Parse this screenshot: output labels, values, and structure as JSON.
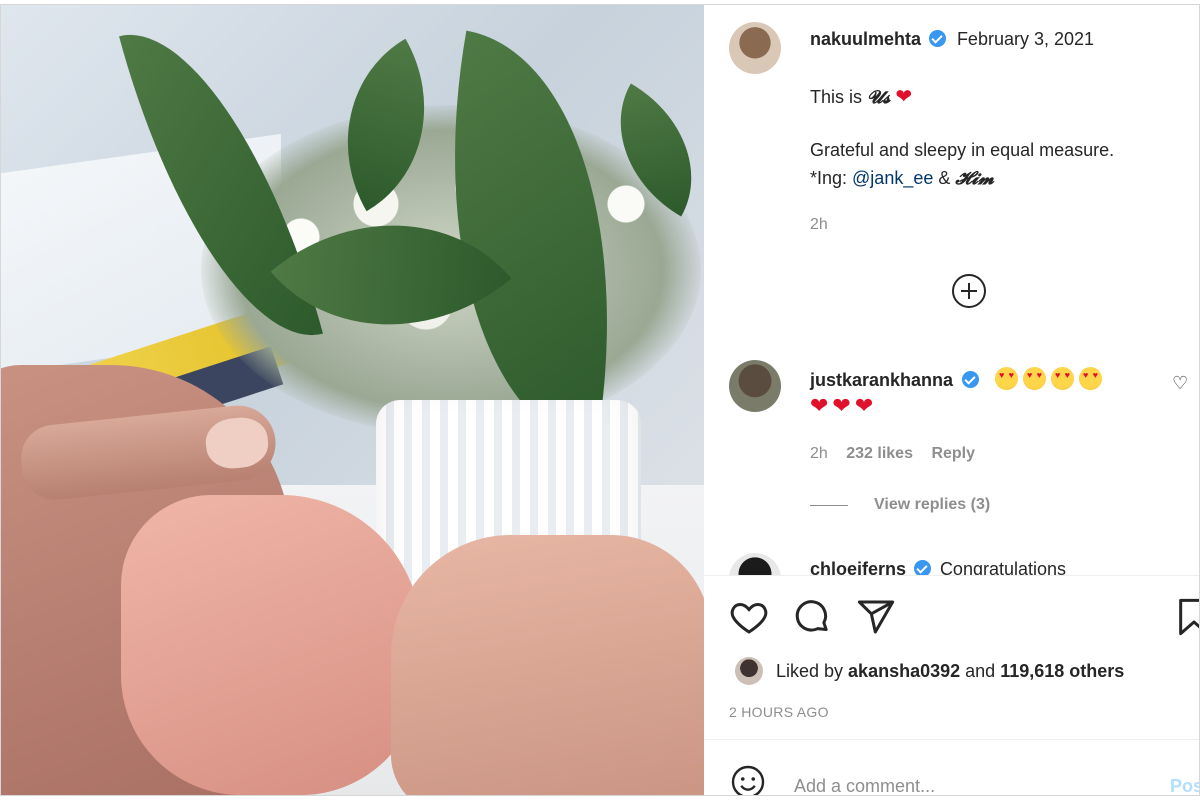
{
  "post": {
    "author": "nakuulmehta",
    "date": "February 3, 2021",
    "caption_line1_prefix": "This is ",
    "caption_styled_word": "𝓤𝓼",
    "caption_heart": "❤",
    "caption_line2": "Grateful and sleepy in equal measure.",
    "caption_line3_prefix": "*Ing: ",
    "caption_mention": "@jank_ee",
    "caption_line3_mid": " & ",
    "caption_styled_him": "𝓗𝓲𝓶",
    "caption_time": "2h"
  },
  "comments": [
    {
      "username": "justkarankhanna",
      "emoji_faces": 4,
      "hearts": "❤❤❤",
      "time": "2h",
      "likes": "232 likes",
      "reply_label": "Reply",
      "view_replies": "View replies (3)"
    },
    {
      "username": "chloeiferns",
      "text": "Congratulations"
    }
  ],
  "actions": {
    "liked_by_prefix": "Liked by ",
    "liked_by_user": "akansha0392",
    "liked_by_mid": " and ",
    "liked_by_count": "119,618 others",
    "timestamp": "2 HOURS AGO"
  },
  "comment_box": {
    "placeholder": "Add a comment...",
    "post_label": "Post"
  },
  "icons": {
    "like": "heart-icon",
    "comment": "comment-icon",
    "share": "share-icon",
    "save": "bookmark-icon",
    "emoji": "emoji-icon",
    "add": "plus-circle-icon"
  },
  "colors": {
    "link": "#00376b",
    "verified": "#3897f0",
    "heart": "#e0112b"
  }
}
